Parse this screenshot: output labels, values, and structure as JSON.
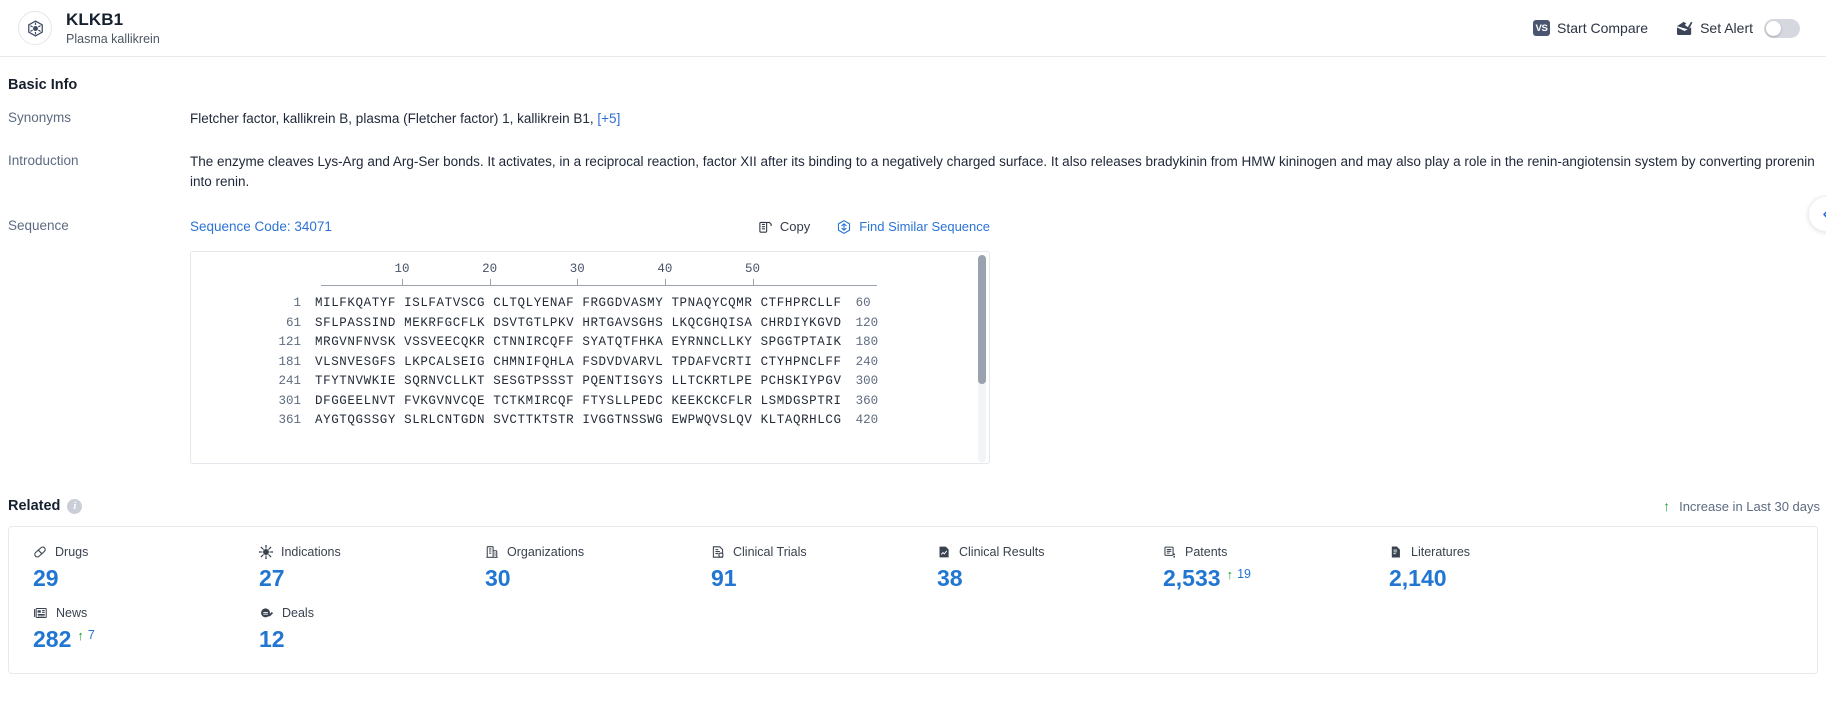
{
  "header": {
    "logo_icon": "target-crosshair-icon",
    "title": "KLKB1",
    "subtitle": "Plasma kallikrein",
    "start_compare_label": "Start Compare",
    "vs_badge": "VS",
    "set_alert_label": "Set Alert",
    "alert_toggle_state": "off"
  },
  "basic_info": {
    "section_title": "Basic Info",
    "synonyms_label": "Synonyms",
    "synonyms_value": "Fletcher factor,  kallikrein B, plasma (Fletcher factor) 1,  kallikrein B1,",
    "synonyms_more": "[+5]",
    "introduction_label": "Introduction",
    "introduction_value": "The enzyme cleaves Lys-Arg and Arg-Ser bonds. It activates, in a reciprocal reaction, factor XII after its binding to a negatively charged surface. It also releases bradykinin from HMW kininogen and may also play a role in the renin-angiotensin system by converting prorenin into renin."
  },
  "sequence": {
    "label": "Sequence",
    "code_label": "Sequence Code: 34071",
    "copy_label": "Copy",
    "copy_icon": "copy-icon",
    "find_similar_label": "Find Similar Sequence",
    "find_similar_icon": "find-similar-sequence-icon",
    "ruler_ticks": [
      10,
      20,
      30,
      40,
      50
    ],
    "lines": [
      {
        "start": "1",
        "chunks": "MILFKQATYF ISLFATVSCG CLTQLYENAF FRGGDVASMY TPNAQYCQMR CTFHPRCLLF",
        "end": "60"
      },
      {
        "start": "61",
        "chunks": "SFLPASSIND MEKRFGCFLK DSVTGTLPKV HRTGAVSGHS LKQCGHQISA CHRDIYKGVD",
        "end": "120"
      },
      {
        "start": "121",
        "chunks": "MRGVNFNVSK VSSVEECQKR CTNNIRCQFF SYATQTFHKA EYRNNCLLKY SPGGTPTAIK",
        "end": "180"
      },
      {
        "start": "181",
        "chunks": "VLSNVESGFS LKPCALSEIG CHMNIFQHLA FSDVDVARVL TPDAFVCRTI CTYHPNCLFF",
        "end": "240"
      },
      {
        "start": "241",
        "chunks": "TFYTNVWKIE SQRNVCLLKT SESGTPSSST PQENTISGYS LLTCKRTLPE PCHSKIYPGV",
        "end": "300"
      },
      {
        "start": "301",
        "chunks": "DFGGEELNVT FVKGVNVCQE TCTKMIRCQF FTYSLLPEDC KEEKCKCFLR LSMDGSPTRI",
        "end": "360"
      },
      {
        "start": "361",
        "chunks": "AYGTQGSSGY SLRLCNTGDN SVCTTKTSTR IVGGTNSSWG EWPWQVSLQV KLTAQRHLCG",
        "end": "420"
      }
    ]
  },
  "related": {
    "title": "Related",
    "info_icon": "info-icon",
    "legend_label": "Increase in Last 30 days",
    "legend_icon": "arrow-up-icon",
    "cards": [
      {
        "icon": "pill-icon",
        "label": "Drugs",
        "value": "29",
        "delta": ""
      },
      {
        "icon": "virus-icon",
        "label": "Indications",
        "value": "27",
        "delta": ""
      },
      {
        "icon": "building-icon",
        "label": "Organizations",
        "value": "30",
        "delta": ""
      },
      {
        "icon": "clinical-trial-icon",
        "label": "Clinical Trials",
        "value": "91",
        "delta": ""
      },
      {
        "icon": "clinical-result-icon",
        "label": "Clinical Results",
        "value": "38",
        "delta": ""
      },
      {
        "icon": "patent-icon",
        "label": "Patents",
        "value": "2,533",
        "delta": "19"
      },
      {
        "icon": "literature-icon",
        "label": "Literatures",
        "value": "2,140",
        "delta": ""
      },
      {
        "icon": "",
        "label": "",
        "value": "",
        "delta": ""
      },
      {
        "icon": "news-icon",
        "label": "News",
        "value": "282",
        "delta": "7"
      },
      {
        "icon": "deal-icon",
        "label": "Deals",
        "value": "12",
        "delta": ""
      }
    ]
  },
  "float_button": {
    "icon": "chevron-left-icon"
  },
  "colors": {
    "accent_blue": "#2176d2",
    "link_blue": "#2b73d4",
    "increase_green": "#22a03f",
    "header_dark": "#16202e"
  }
}
